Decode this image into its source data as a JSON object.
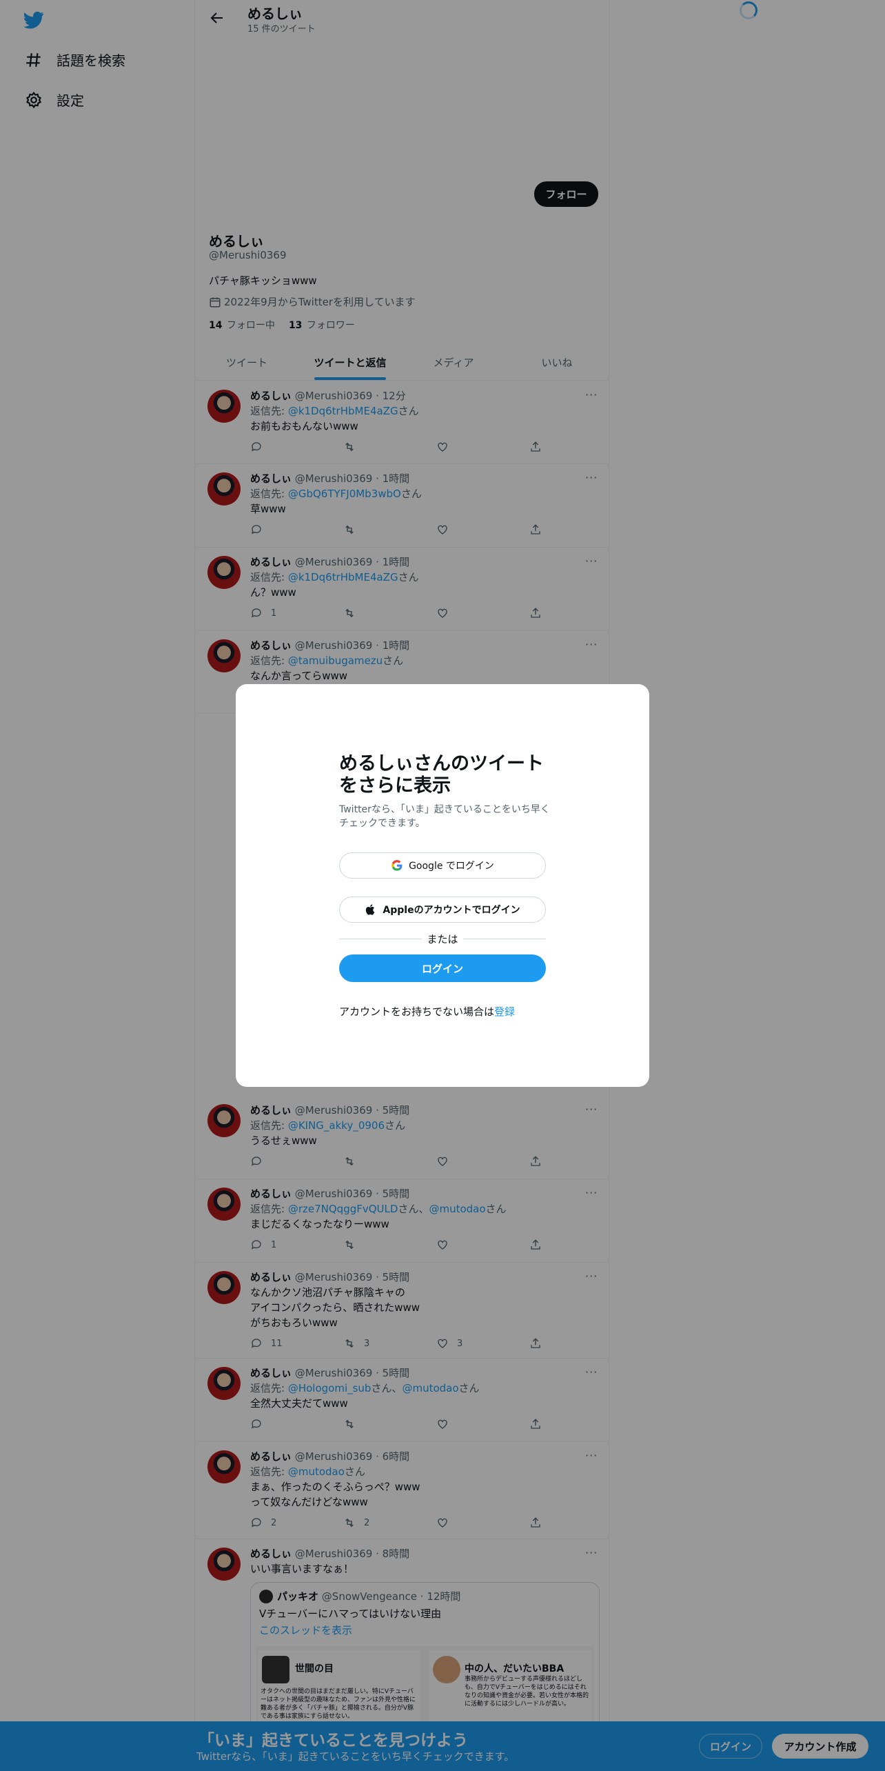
{
  "sidebar": {
    "items": [
      {
        "label": "話題を検索",
        "icon": "hashtag-icon"
      },
      {
        "label": "設定",
        "icon": "gear-icon"
      }
    ]
  },
  "header": {
    "title": "めるしぃ",
    "subtitle": "15 件のツイート"
  },
  "profile": {
    "follow_label": "フォロー",
    "name": "めるしぃ",
    "handle": "@Merushi0369",
    "bio": "パチャ豚キッショwww",
    "joined": "2022年9月からTwitterを利用しています",
    "following_count": "14",
    "following_label": "フォロー中",
    "followers_count": "13",
    "followers_label": "フォロワー"
  },
  "tabs": [
    "ツイート",
    "ツイートと返信",
    "メディア",
    "いいね"
  ],
  "tweets": [
    {
      "name": "めるしぃ",
      "meta": "@Merushi0369 · 12分",
      "reply_prefix": "返信先: ",
      "reply_to": "@k1Dq6trHbME4aZG",
      "reply_suffix": "さん",
      "text": "お前もおもんないwww",
      "replies": "",
      "retweets": "",
      "likes": ""
    },
    {
      "name": "めるしぃ",
      "meta": "@Merushi0369 · 1時間",
      "reply_prefix": "返信先: ",
      "reply_to": "@GbQ6TYFJ0Mb3wbO",
      "reply_suffix": "さん",
      "text": "草www",
      "replies": "",
      "retweets": "",
      "likes": ""
    },
    {
      "name": "めるしぃ",
      "meta": "@Merushi0369 · 1時間",
      "reply_prefix": "返信先: ",
      "reply_to": "@k1Dq6trHbME4aZG",
      "reply_suffix": "さん",
      "text": "ん？www",
      "replies": "1",
      "retweets": "",
      "likes": ""
    },
    {
      "name": "めるしぃ",
      "meta": "@Merushi0369 · 1時間",
      "reply_prefix": "返信先: ",
      "reply_to": "@tamuibugamezu",
      "reply_suffix": "さん",
      "text": "なんか言ってらwww"
    },
    {
      "name": "めるしぃ",
      "meta": "@Merushi0369 · 5時間",
      "reply_prefix": "返信先: ",
      "reply_to": "@KING_akky_0906",
      "reply_suffix": "さん",
      "text": "うるせぇwww",
      "replies": "",
      "retweets": "",
      "likes": ""
    },
    {
      "name": "めるしぃ",
      "meta": "@Merushi0369 · 5時間",
      "reply_prefix": "返信先: ",
      "reply_to": "@rze7NQqggFvQULD",
      "reply_mid": "さん、",
      "reply_to2": "@mutodao",
      "reply_suffix": "さん",
      "text": "まじだるくなったなりーwww",
      "replies": "1",
      "retweets": "",
      "likes": ""
    },
    {
      "name": "めるしぃ",
      "meta": "@Merushi0369 · 5時間",
      "lines": [
        "なんかクソ池沼パチャ豚陰キャの",
        "アイコンパクったら、晒されたwww",
        "がちおもろいwww"
      ],
      "replies": "11",
      "retweets": "3",
      "likes": "3"
    },
    {
      "name": "めるしぃ",
      "meta": "@Merushi0369 · 5時間",
      "reply_prefix": "返信先: ",
      "reply_to": "@Hologomi_sub",
      "reply_mid": "さん、",
      "reply_to2": "@mutodao",
      "reply_suffix": "さん",
      "text": "全然大丈夫だてwww",
      "replies": "",
      "retweets": "",
      "likes": ""
    },
    {
      "name": "めるしぃ",
      "meta": "@Merushi0369 · 6時間",
      "reply_prefix": "返信先: ",
      "reply_to": "@mutodao",
      "reply_suffix": "さん",
      "lines": [
        "まぁ、作ったのくそふらっぺ？www",
        "って奴なんだけどなwww"
      ],
      "replies": "2",
      "retweets": "2",
      "likes": ""
    },
    {
      "name": "めるしぃ",
      "meta": "@Merushi0369 · 8時間",
      "text": "いい事言いますなぁ！"
    }
  ],
  "quote": {
    "name": "パッキオ",
    "meta": "@SnowVengeance · 12時間",
    "text": "Vチューバーにハマってはいけない理由",
    "link": "このスレッドを表示",
    "card1_title": "世間の目",
    "card1_text": "オタクへの世間の目はまだまだ厳しい。特にVチューバーはネット掲級型の趣味なため、ファンは外見や性格に難ある者が多く「パチャ豚」と揶揄される。自分がV豚である事は家族にすら話せない。",
    "card2_title": "中の人、だいたいBBA",
    "card2_text": "事務所からデビューする声優様れるほどしも、自力でVチューバーをはじめるにはそれなりの知識や資金が必要。若い女性が本格的に活動するには少しハードルが高い。"
  },
  "modal": {
    "title": "めるしぃさんのツイートをさらに表示",
    "subtitle": "Twitterなら、「いま」起きていることをいち早くチェックできます。",
    "google_label": "Google でログイン",
    "apple_label": "Appleのアカウントでログイン",
    "or_label": "または",
    "login_label": "ログイン",
    "signup_prefix": "アカウントをお持ちでない場合は",
    "signup_link": "登録"
  },
  "bottom_bar": {
    "title": "「いま」起きていることを見つけよう",
    "subtitle": "Twitterなら、「いま」起きていることをいち早くチェックできます。",
    "login_label": "ログイン",
    "signup_label": "アカウント作成"
  },
  "colors": {
    "accent": "#1d9bf0",
    "text": "#0f1419",
    "muted": "#536471"
  }
}
